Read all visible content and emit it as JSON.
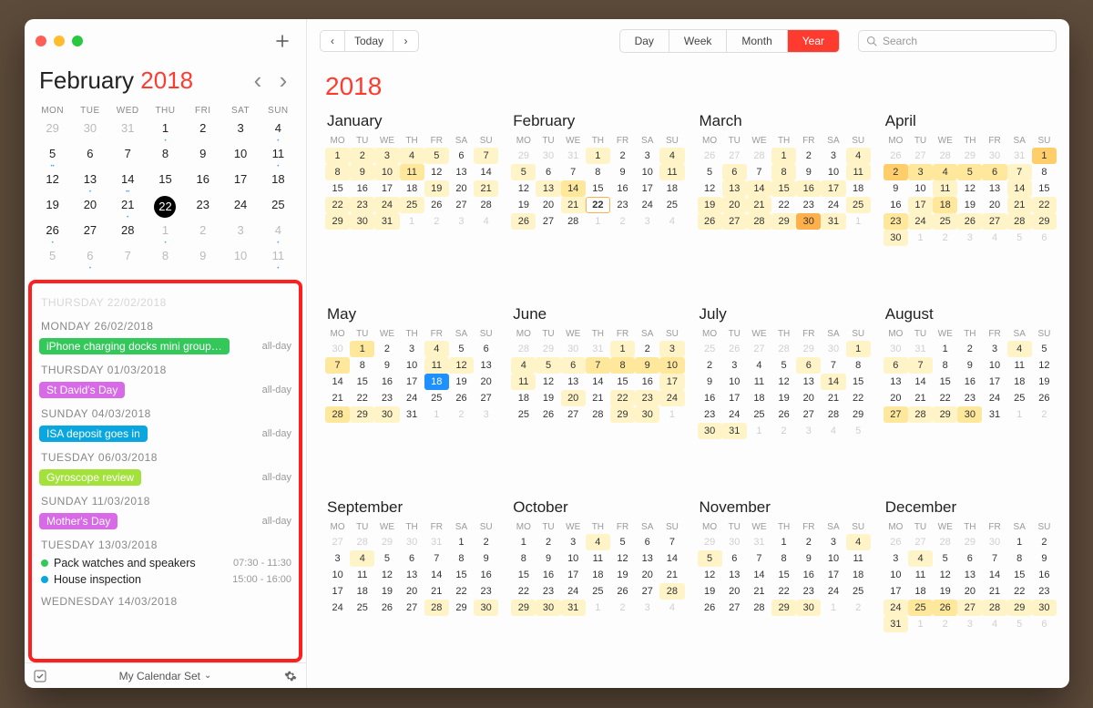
{
  "toolbar": {
    "today_label": "Today",
    "views": [
      "Day",
      "Week",
      "Month",
      "Year"
    ],
    "active_view": "Year",
    "search_placeholder": "Search"
  },
  "sidebar": {
    "month_label": "February",
    "year_label": "2018",
    "dow": [
      "MON",
      "TUE",
      "WED",
      "THU",
      "FRI",
      "SAT",
      "SUN"
    ],
    "today": 22,
    "weeks": [
      [
        {
          "n": 29,
          "dim": 1
        },
        {
          "n": 30,
          "dim": 1
        },
        {
          "n": 31,
          "dim": 1
        },
        {
          "n": 1,
          "dots": "•"
        },
        {
          "n": 2
        },
        {
          "n": 3
        },
        {
          "n": 4,
          "dots": "•"
        }
      ],
      [
        {
          "n": 5,
          "dots": "••"
        },
        {
          "n": 6
        },
        {
          "n": 7
        },
        {
          "n": 8
        },
        {
          "n": 9
        },
        {
          "n": 10
        },
        {
          "n": 11,
          "dots": "•"
        }
      ],
      [
        {
          "n": 12
        },
        {
          "n": 13,
          "dots": "•"
        },
        {
          "n": 14,
          "dots": "••"
        },
        {
          "n": 15
        },
        {
          "n": 16
        },
        {
          "n": 17
        },
        {
          "n": 18
        }
      ],
      [
        {
          "n": 19
        },
        {
          "n": 20
        },
        {
          "n": 21,
          "dots": "•"
        },
        {
          "n": 22,
          "today": 1
        },
        {
          "n": 23
        },
        {
          "n": 24
        },
        {
          "n": 25
        }
      ],
      [
        {
          "n": 26,
          "dots": "•"
        },
        {
          "n": 27
        },
        {
          "n": 28
        },
        {
          "n": 1,
          "dim": 1,
          "dots": "•"
        },
        {
          "n": 2,
          "dim": 1
        },
        {
          "n": 3,
          "dim": 1
        },
        {
          "n": 4,
          "dim": 1,
          "dots": "•"
        }
      ],
      [
        {
          "n": 5,
          "dim": 1
        },
        {
          "n": 6,
          "dim": 1,
          "dots": "•"
        },
        {
          "n": 7,
          "dim": 1
        },
        {
          "n": 8,
          "dim": 1
        },
        {
          "n": 9,
          "dim": 1
        },
        {
          "n": 10,
          "dim": 1
        },
        {
          "n": 11,
          "dim": 1,
          "dots": "•"
        }
      ]
    ],
    "calendar_set_label": "My Calendar Set"
  },
  "agenda": [
    {
      "header": "THURSDAY 22/02/2018",
      "faded": true
    },
    {
      "header": "MONDAY 26/02/2018",
      "events": [
        {
          "type": "pill",
          "color": "#34c759",
          "label": "iPhone charging docks mini group…",
          "time": "all-day"
        }
      ]
    },
    {
      "header": "THURSDAY 01/03/2018",
      "events": [
        {
          "type": "pill",
          "color": "#d86ae8",
          "label": "St David's Day",
          "time": "all-day"
        }
      ]
    },
    {
      "header": "SUNDAY 04/03/2018",
      "events": [
        {
          "type": "pill",
          "color": "#0aa6e0",
          "label": "ISA deposit goes in",
          "time": "all-day"
        }
      ]
    },
    {
      "header": "TUESDAY 06/03/2018",
      "events": [
        {
          "type": "pill",
          "color": "#a2e23a",
          "label": "Gyroscope review",
          "time": "all-day"
        }
      ]
    },
    {
      "header": "SUNDAY 11/03/2018",
      "events": [
        {
          "type": "pill",
          "color": "#d86ae8",
          "label": "Mother's Day",
          "time": "all-day"
        }
      ]
    },
    {
      "header": "TUESDAY 13/03/2018",
      "events": [
        {
          "type": "dot",
          "color": "#34c759",
          "label": "Pack watches and speakers",
          "time": "07:30 - 11:30"
        },
        {
          "type": "dot",
          "color": "#0aa6e0",
          "label": "House inspection",
          "time": "15:00 - 16:00"
        }
      ]
    },
    {
      "header": "WEDNESDAY 14/03/2018"
    }
  ],
  "year_view": {
    "year": "2018",
    "dow": [
      "MO",
      "TU",
      "WE",
      "TH",
      "FR",
      "SA",
      "SU"
    ],
    "months": [
      {
        "name": "January",
        "start": 0,
        "days": 31,
        "prev": 31,
        "hl": {
          "1": 1,
          "2": 1,
          "3": 1,
          "4": 1,
          "5": 1,
          "7": 1,
          "8": 1,
          "9": 1,
          "10": 1,
          "11": 2,
          "19": 1,
          "21": 1,
          "22": 1,
          "23": 1,
          "24": 1,
          "25": 1,
          "29": 1,
          "30": 1,
          "31": 1
        }
      },
      {
        "name": "February",
        "start": 3,
        "days": 28,
        "prev": 31,
        "today": 22,
        "hl": {
          "1": 1,
          "4": 1,
          "5": 1,
          "11": 1,
          "13": 1,
          "14": 2,
          "21": 1,
          "26": 1
        }
      },
      {
        "name": "March",
        "start": 3,
        "days": 31,
        "prev": 28,
        "hl": {
          "1": 1,
          "4": 1,
          "6": 1,
          "8": 1,
          "11": 1,
          "13": 1,
          "14": 1,
          "15": 1,
          "16": 1,
          "17": 1,
          "19": 1,
          "20": 1,
          "21": 1,
          "25": 1,
          "26": 1,
          "27": 1,
          "28": 1,
          "29": 1,
          "30": 4,
          "31": 1
        }
      },
      {
        "name": "April",
        "start": 6,
        "days": 30,
        "prev": 31,
        "hl": {
          "1": 3,
          "2": 3,
          "3": 2,
          "4": 2,
          "5": 2,
          "6": 2,
          "7": 1,
          "11": 1,
          "14": 1,
          "17": 1,
          "18": 2,
          "21": 1,
          "22": 1,
          "23": 2,
          "24": 1,
          "25": 1,
          "26": 1,
          "27": 1,
          "28": 1,
          "29": 1,
          "30": 1
        }
      },
      {
        "name": "May",
        "start": 1,
        "days": 31,
        "prev": 30,
        "blue": 18,
        "hl": {
          "1": 2,
          "4": 1,
          "7": 2,
          "11": 1,
          "12": 1,
          "28": 2,
          "29": 1,
          "30": 1
        }
      },
      {
        "name": "June",
        "start": 4,
        "days": 30,
        "prev": 31,
        "hl": {
          "1": 1,
          "3": 1,
          "4": 1,
          "5": 1,
          "6": 1,
          "7": 2,
          "8": 2,
          "9": 2,
          "10": 2,
          "11": 1,
          "17": 1,
          "20": 1,
          "22": 1,
          "23": 1,
          "24": 1,
          "29": 1,
          "30": 1
        }
      },
      {
        "name": "July",
        "start": 6,
        "days": 31,
        "prev": 30,
        "hl": {
          "1": 1,
          "6": 1,
          "14": 1,
          "30": 1,
          "31": 1
        }
      },
      {
        "name": "August",
        "start": 2,
        "days": 31,
        "prev": 31,
        "hl": {
          "4": 1,
          "6": 1,
          "7": 1,
          "27": 2,
          "28": 1,
          "29": 1,
          "30": 2
        }
      },
      {
        "name": "September",
        "start": 5,
        "days": 30,
        "prev": 31,
        "hl": {
          "4": 1,
          "28": 1,
          "30": 1
        }
      },
      {
        "name": "October",
        "start": 0,
        "days": 31,
        "prev": 30,
        "hl": {
          "4": 1,
          "28": 1,
          "29": 1,
          "30": 1,
          "31": 1
        }
      },
      {
        "name": "November",
        "start": 3,
        "days": 30,
        "prev": 31,
        "hl": {
          "4": 1,
          "5": 1,
          "29": 1,
          "30": 1
        }
      },
      {
        "name": "December",
        "start": 5,
        "days": 31,
        "prev": 30,
        "hl": {
          "4": 1,
          "24": 1,
          "25": 2,
          "26": 2,
          "27": 1,
          "28": 1,
          "29": 1,
          "30": 1,
          "31": 1
        }
      }
    ]
  }
}
